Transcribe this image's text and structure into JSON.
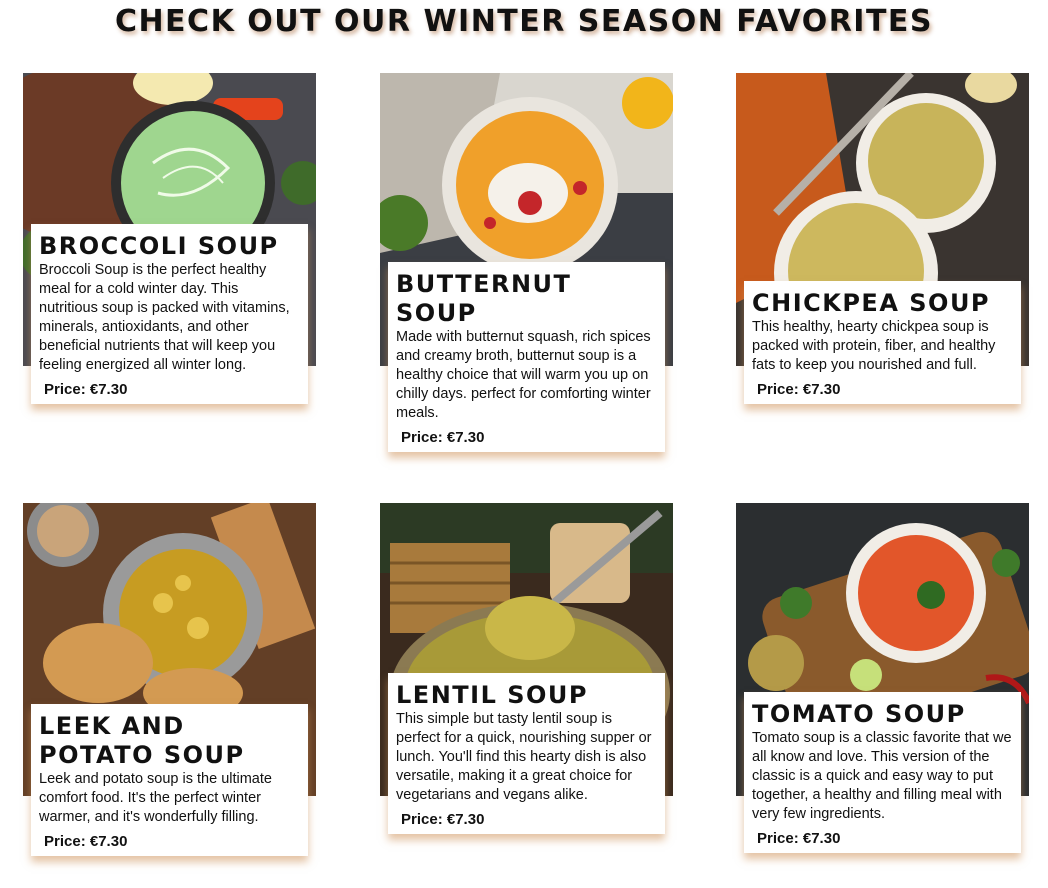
{
  "page_title": "CHECK OUT OUR WINTER SEASON FAVORITES",
  "price_label": "Price:",
  "soups": [
    {
      "name": "BROCCOLI SOUP",
      "description": "Broccoli Soup is the perfect healthy meal for a cold winter day. This nutritious soup is packed with vitamins, minerals, antioxidants, and other beneficial nutrients that will keep you feeling energized all winter long.",
      "price": "€7.30",
      "image": "broccoli-soup-photo"
    },
    {
      "name": "BUTTERNUT SOUP",
      "description": "Made with butternut squash, rich spices and creamy broth, butternut soup is a healthy choice that will warm you up on chilly days. perfect for comforting winter meals.",
      "price": "€7.30",
      "image": "butternut-soup-photo"
    },
    {
      "name": "CHICKPEA SOUP",
      "description": "This healthy, hearty chickpea soup is packed with protein, fiber, and healthy fats to keep you nourished and full.",
      "price": "€7.30",
      "image": "chickpea-soup-photo"
    },
    {
      "name": "LEEK AND POTATO SOUP",
      "description": "Leek and potato soup is the ultimate comfort food. It's the perfect winter warmer, and it's wonderfully filling.",
      "price": "€7.30",
      "image": "leek-potato-soup-photo"
    },
    {
      "name": "LENTIL SOUP",
      "description": "This simple but tasty lentil soup is perfect for a quick, nourishing supper or lunch. You'll find this hearty dish is also versatile, making it a great choice for vegetarians and vegans alike.",
      "price": "€7.30",
      "image": "lentil-soup-photo"
    },
    {
      "name": "TOMATO SOUP",
      "description": "Tomato soup is a classic favorite that we all know and love. This version of the classic is a quick and easy way to put together, a healthy and filling meal with very few ingredients.",
      "price": "€7.30",
      "image": "tomato-soup-photo"
    }
  ],
  "colors": {
    "title_shadow": "#a05a28",
    "card_shadow": "#cd915a",
    "text": "#111111"
  }
}
